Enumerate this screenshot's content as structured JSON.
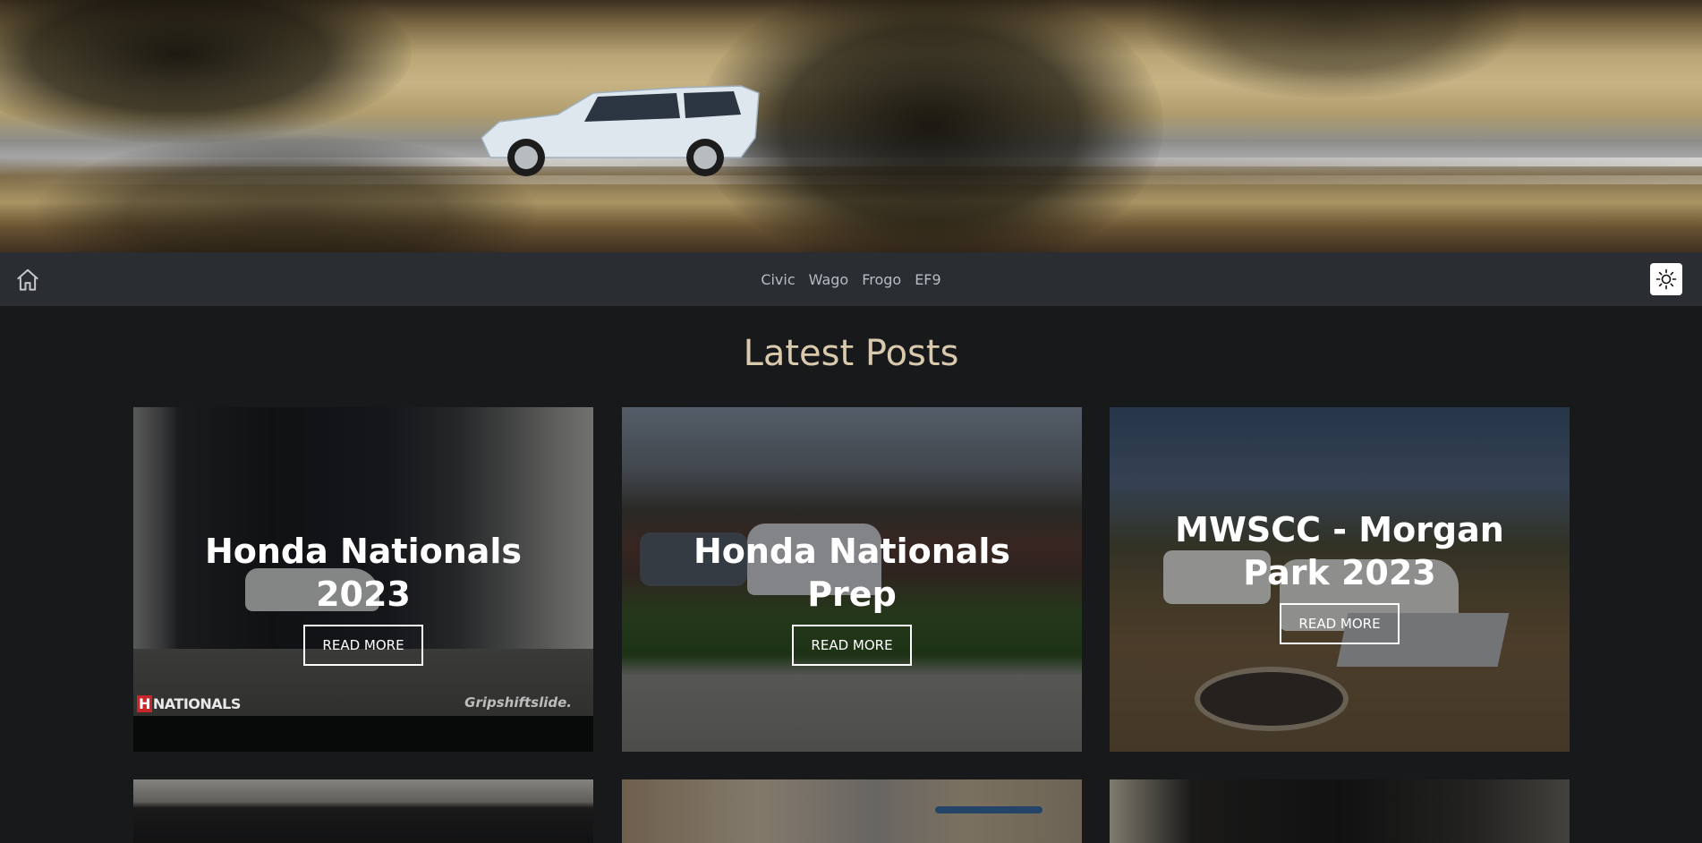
{
  "nav": {
    "links": [
      "Civic",
      "Wago",
      "Frogo",
      "EF9"
    ]
  },
  "main": {
    "title": "Latest Posts",
    "posts": [
      {
        "title": "Honda Nationals 2023",
        "button": "READ MORE",
        "watermark_left_letter": "H",
        "watermark_left_text": "NATIONALS",
        "watermark_right": "Gripshiftslide."
      },
      {
        "title": "Honda Nationals Prep",
        "button": "READ MORE"
      },
      {
        "title": "MWSCC - Morgan Park 2023",
        "button": "READ MORE"
      }
    ]
  },
  "colors": {
    "page_bg": "#18191b",
    "navbar_bg": "#2a2d31",
    "title_color": "#d9c9ad"
  },
  "icons": {
    "home": "home-icon",
    "theme": "sun-icon"
  }
}
